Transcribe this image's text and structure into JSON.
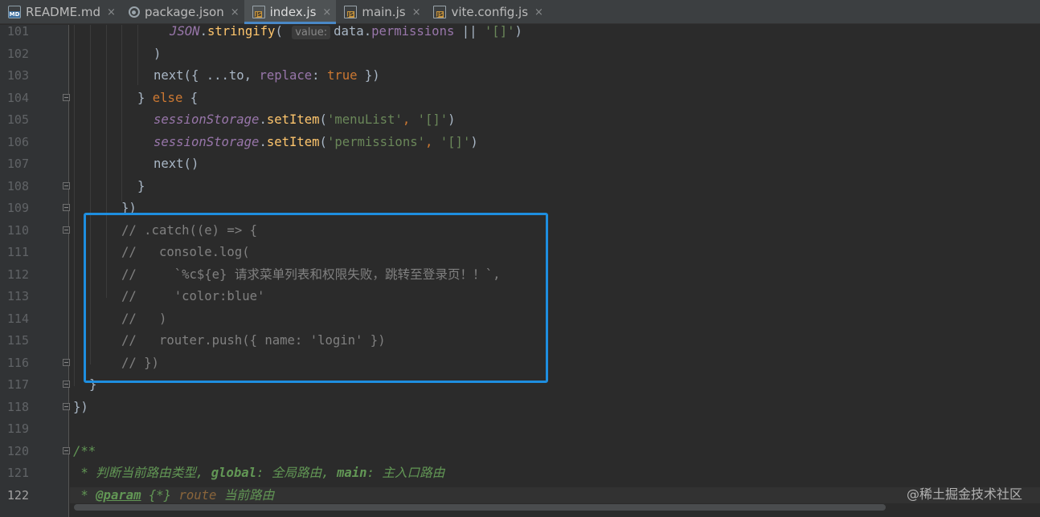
{
  "tabs": [
    {
      "label": "README.md",
      "icon": "markdown-file-icon",
      "icon_text": "MD",
      "active": false
    },
    {
      "label": "package.json",
      "icon": "package-json-icon",
      "icon_text": "",
      "active": false
    },
    {
      "label": "index.js",
      "icon": "js-file-icon",
      "icon_text": "JS",
      "active": true
    },
    {
      "label": "main.js",
      "icon": "js-file-icon",
      "icon_text": "JS",
      "active": false
    },
    {
      "label": "vite.config.js",
      "icon": "js-file-icon",
      "icon_text": "JS",
      "active": false
    }
  ],
  "close_glyph": "×",
  "gutter": {
    "line_numbers": [
      "101",
      "102",
      "103",
      "104",
      "105",
      "106",
      "107",
      "108",
      "109",
      "110",
      "111",
      "112",
      "113",
      "114",
      "115",
      "116",
      "117",
      "118",
      "119",
      "120",
      "121",
      "122"
    ],
    "current_line": "122"
  },
  "code": {
    "l101_a": "JSON",
    "l101_b": ".",
    "l101_c": "stringify",
    "l101_d": "( ",
    "l101_hint": "value:",
    "l101_e": "data",
    "l101_f": ".",
    "l101_g": "permissions",
    "l101_h": " || ",
    "l101_i": "'[]'",
    "l101_j": ")",
    "l102": ")",
    "l103_a": "next({ ...to, ",
    "l103_b": "replace",
    "l103_c": ": ",
    "l103_d": "true",
    "l103_e": " })",
    "l104_a": "} ",
    "l104_b": "else",
    "l104_c": " {",
    "l105_a": "sessionStorage",
    "l105_b": ".",
    "l105_c": "setItem",
    "l105_d": "(",
    "l105_e": "'menuList'",
    "l105_f": ", ",
    "l105_g": "'[]'",
    "l105_h": ")",
    "l106_a": "sessionStorage",
    "l106_b": ".",
    "l106_c": "setItem",
    "l106_d": "(",
    "l106_e": "'permissions'",
    "l106_f": ", ",
    "l106_g": "'[]'",
    "l106_h": ")",
    "l107": "next()",
    "l108": "}",
    "l109": "})",
    "l110": "// .catch((e) => {",
    "l111": "//   console.log(",
    "l112": "//     `%c${e} 请求菜单列表和权限失败，跳转至登录页！！`,",
    "l113": "//     'color:blue'",
    "l114": "//   )",
    "l115": "//   router.push({ name: 'login' })",
    "l116": "// })",
    "l117": "}",
    "l118": "})",
    "l119": "",
    "l120": "/**",
    "l121_a": " * 判断当前路由类型, ",
    "l121_b": "global",
    "l121_c": ": 全局路由, ",
    "l121_d": "main",
    "l121_e": ": 主入口路由",
    "l122_a": " * ",
    "l122_b": "@param",
    "l122_c": " ",
    "l122_d": "{*}",
    "l122_e": " route",
    "l122_f": " 当前路由"
  },
  "watermark": "@稀土掘金技术社区",
  "colors": {
    "highlight_box": "#1e8ee0",
    "active_tab_underline": "#4a88c7"
  }
}
